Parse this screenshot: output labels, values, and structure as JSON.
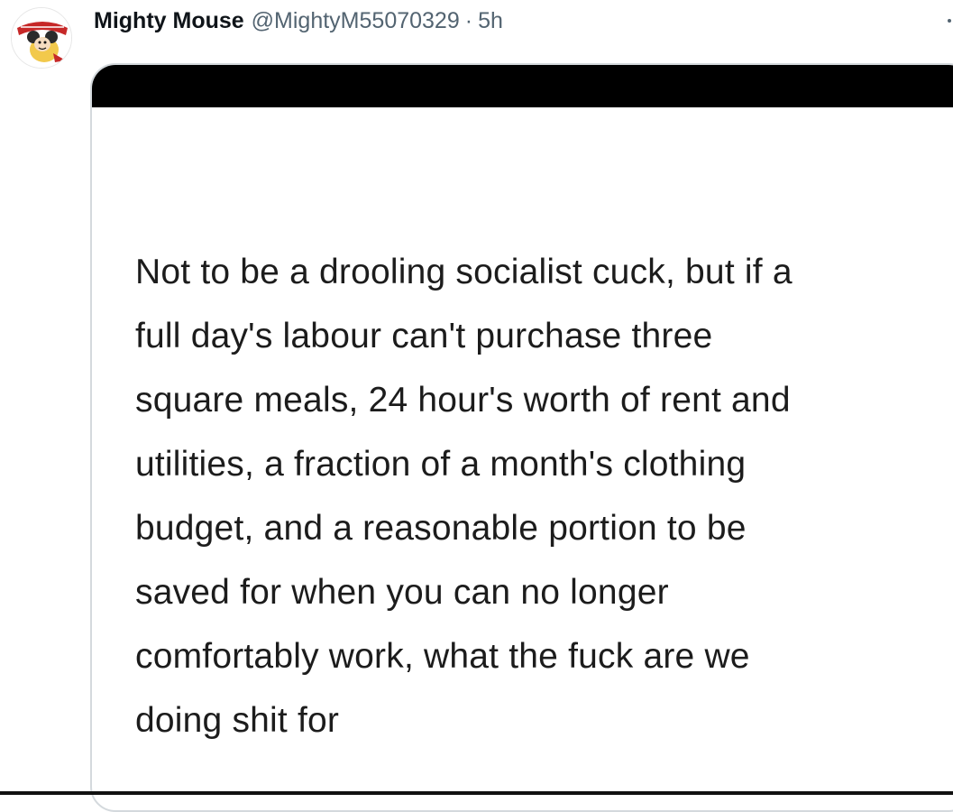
{
  "tweet": {
    "author": {
      "display_name": "Mighty Mouse",
      "handle": "@MightyM55070329",
      "avatar_icon": "mighty-mouse-avatar-icon"
    },
    "separator": "·",
    "timestamp": "5h",
    "more_icon": "more-icon"
  },
  "media": {
    "post_text_lines": [
      "Not to be a drooling socialist cuck, but if a",
      "full day's labour can't purchase three",
      "square meals, 24 hour's worth of rent and",
      "utilities, a fraction of a month's clothing",
      "budget, and a reasonable portion to be",
      "saved for when you can no longer",
      "comfortably work, what the fuck are we",
      "doing shit for"
    ]
  },
  "colors": {
    "text_primary": "#0f1419",
    "text_secondary": "#536471",
    "card_border": "#d4d9dd",
    "media_bar": "#000000"
  }
}
